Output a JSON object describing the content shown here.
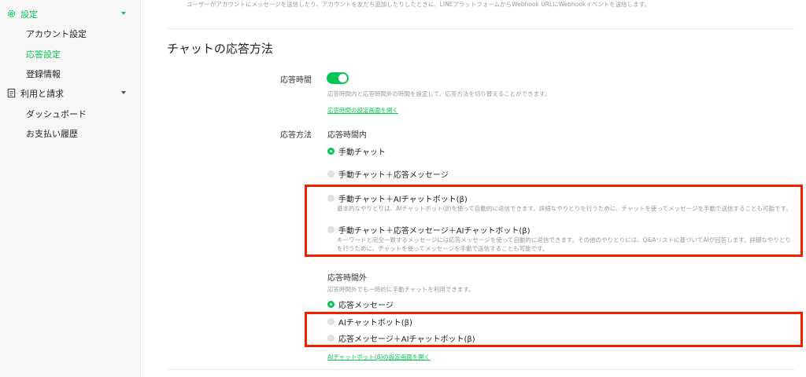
{
  "sidebar": {
    "settings": "設定",
    "account": "アカウント設定",
    "response": "応答設定",
    "registration": "登録情報",
    "billing": "利用と請求",
    "dashboard": "ダッシュボード",
    "payment_history": "お支払い履歴"
  },
  "top_note": "ユーザーがアカウントにメッセージを送信したり、アカウントを友だち追加したりしたときに、LINEプラットフォームからWebhook URLにWebhookイベントを送信します。",
  "section_title": "チャットの応答方法",
  "hours": {
    "label": "応答時間",
    "help": "応答時間内と応答時間外の時間を設定して、応答方法を切り替えることができます。",
    "link": "応答時間の設定画面を開く",
    "enabled": true
  },
  "method": {
    "label": "応答方法",
    "within_title": "応答時間内",
    "within_options": [
      {
        "label": "手動チャット",
        "selected": true
      },
      {
        "label": "手動チャット＋応答メッセージ",
        "selected": false
      },
      {
        "label": "手動チャット＋AIチャットボット(β)",
        "selected": false,
        "desc": "基本的なやりとりは、AIチャットボット(β)を使って自動的に返信できます。詳細なやりとりを行うために、チャットを使ってメッセージを手動で送信することも可能です。"
      },
      {
        "label": "手動チャット＋応答メッセージ＋AIチャットボット(β)",
        "selected": false,
        "desc": "キーワードと完全一致するメッセージには応答メッセージを使って自動的に返信できます。その他のやりとりには、Q&Aリストに基づいてAIが回答します。詳細なやりとりを行うために、チャットを使ってメッセージを手動で送信することも可能です。"
      }
    ],
    "outside_title": "応答時間外",
    "outside_help": "応答時間外でも一時的に手動チャットを利用できます。",
    "outside_options": [
      {
        "label": "応答メッセージ",
        "selected": true
      },
      {
        "label": "AIチャットボット(β)",
        "selected": false
      },
      {
        "label": "応答メッセージ＋AIチャットボット(β)",
        "selected": false
      }
    ],
    "bot_link": "AIチャットボット(β)の設定画面を開く"
  },
  "colors": {
    "accent": "#06c755",
    "highlight": "#f21e00"
  }
}
